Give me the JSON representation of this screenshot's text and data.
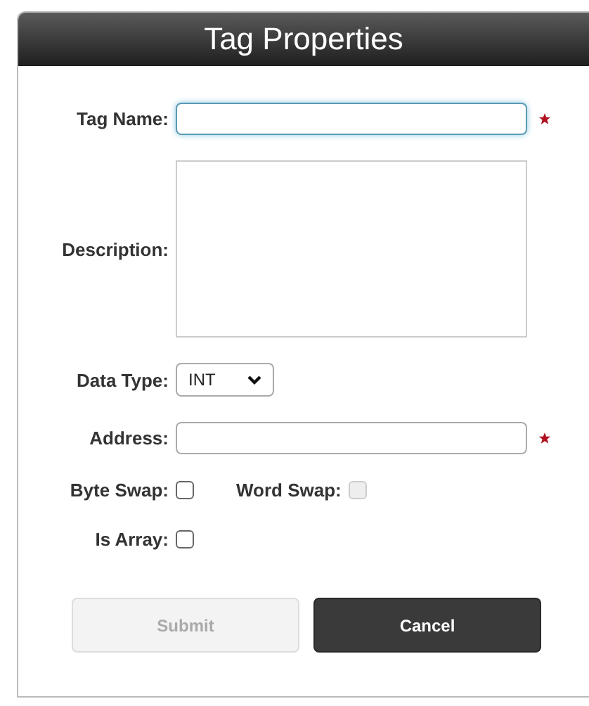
{
  "dialog": {
    "title": "Tag Properties"
  },
  "fields": [
    {
      "kind": "text",
      "label": "Tag Name:",
      "focused": true,
      "required": true
    },
    {
      "kind": "textarea",
      "label": "Description:",
      "focused": false,
      "required": false
    },
    {
      "kind": "select",
      "label": "Data Type:",
      "value": "INT",
      "focused": false,
      "required": false
    },
    {
      "kind": "text",
      "label": "Address:",
      "focused": false,
      "required": true
    }
  ],
  "checkbox_rows": [
    [
      {
        "label": "Byte Swap:",
        "checked": false,
        "disabled": false
      },
      {
        "label": "Word Swap:",
        "checked": false,
        "disabled": true
      }
    ],
    [
      {
        "label": "Is Array:",
        "checked": false,
        "disabled": false
      }
    ]
  ],
  "buttons": [
    {
      "label": "Submit",
      "kind": "secondary",
      "disabled": true
    },
    {
      "label": "Cancel",
      "kind": "primary",
      "disabled": false
    }
  ]
}
